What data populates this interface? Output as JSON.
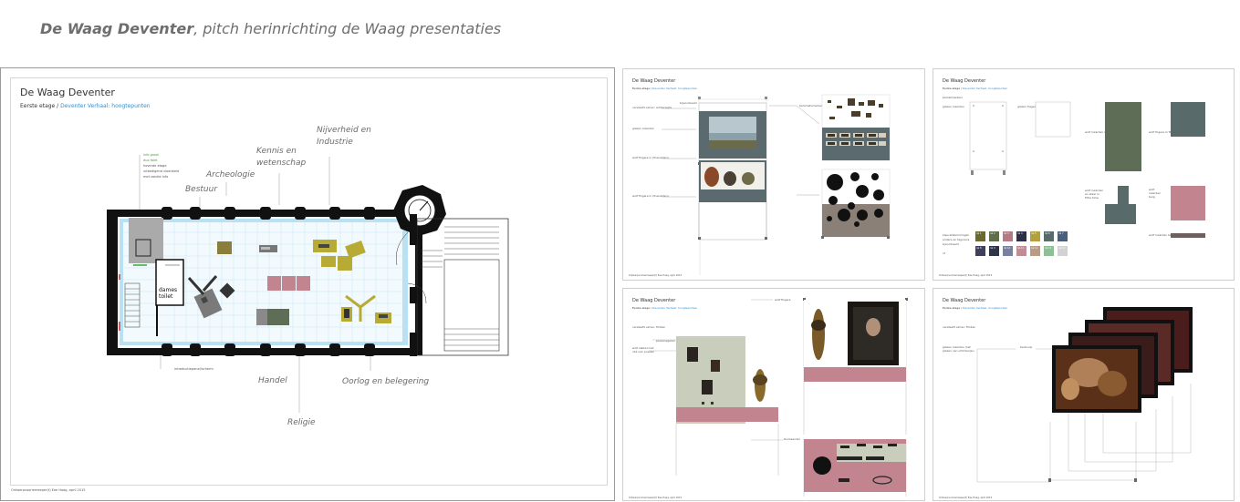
{
  "header": {
    "title_bold": "De Waag Deventer",
    "title_rest": ", pitch herinrichting de Waag presentaties"
  },
  "main_board": {
    "title": "De Waag Deventer",
    "subtitle_plain": "Eerste etage / ",
    "subtitle_link": "Deventer Verhaal: hoogtepunten",
    "zones": {
      "archeologie": "Archeologie",
      "bestuur": "Bestuur",
      "kennis": [
        "Kennis en",
        "wetenschap"
      ],
      "nijverheid": [
        "Nijverheid en",
        "Industrie"
      ],
      "handel": "Handel",
      "religie": "Religie",
      "oorlog": "Oorlog en belegering"
    },
    "legend": [
      "info groot",
      "duo falet",
      "hoverde etage",
      "uitbedigend vloerbield",
      "met zandie info"
    ],
    "toilet_label": [
      "dames",
      "toilet"
    ],
    "screen_label": "introductiepanel/scherm",
    "footer": "Ontwerpvoorlemeeper(t) Eee Haag, april 2015"
  },
  "board_b": {
    "title": "De Waag Deventer",
    "subtitle_plain": "Eerste etage / ",
    "subtitle_link": "Deventer Verhaal: hoogtepunten",
    "labels": [
      "vandeefd simao: achterlegte",
      "glazen inzarden",
      "wolf fixgere in (thenalden)",
      "wolf fixgere in (thenalden)",
      "bijvoorbeeld",
      "bammatomerken",
      "tegem 4469 12x1 + 5x",
      "tegem 4469 12x1 + 5x",
      "tambar",
      "klaras"
    ],
    "footer": "Ontwerpvoorlemeeper(t) Eee Haag, april 2015"
  },
  "board_c": {
    "title": "De Waag Deventer",
    "subtitle_plain": "Eerste etage / ",
    "subtitle_link": "Deventer Verhaal: hoogtepunten",
    "labels": [
      "bamatmarkers",
      "glazen inzarden",
      "glazen fragers",
      "wolf inzarden rondam",
      "wolf frigere in filtre",
      "wolf inzarden en staal in filtre blow",
      "wolf inzarden berg",
      "wolf inzarden berg",
      "kleurafstemmingen",
      "andere en fagorens",
      "bjvoorbeeld",
      "of"
    ],
    "swatches": [
      {
        "label": "ral 1",
        "color": "#6b6a2c"
      },
      {
        "label": "ral 2",
        "color": "#5f6d4c"
      },
      {
        "label": "ral 3",
        "color": "#b57a85"
      },
      {
        "label": "ral 4",
        "color": "#2e2e45"
      },
      {
        "label": "ral 5",
        "color": "#b4a13c"
      },
      {
        "label": "ral 6",
        "color": "#596c6b"
      },
      {
        "label": "ral 7",
        "color": "#4a5e7e"
      },
      {
        "label": "ral 8",
        "color": "#3f3f5e"
      },
      {
        "label": "ral 9",
        "color": "#2f3448"
      },
      {
        "label": "ral 10",
        "color": "#7a7fa4"
      },
      {
        "label": "ral 11",
        "color": "#bf8d96"
      },
      {
        "label": "ral 12",
        "color": "#b99c82"
      },
      {
        "label": "ral 13",
        "color": "#8fbf96"
      },
      {
        "label": "ral 14",
        "color": "#d2d2d2"
      }
    ],
    "footer": "Ontwerpvoorlemeeper(t) Eee Haag, april 2015"
  },
  "board_d": {
    "title": "De Waag Deventer",
    "subtitle_plain": "Eerste etage / ",
    "subtitle_link": "Deventer Verhaal: hoogtepunten",
    "labels": [
      "vandeefd simao: fimbsn",
      "personagaren",
      "wolf zakkel met obk van poeden",
      "wolf fixgere",
      "fenmsander"
    ],
    "footer": "Ontwerpvoorlemeeper(t) Eee Haag, april 2015"
  },
  "board_e": {
    "title": "De Waag Deventer",
    "subtitle_plain": "Eerste etage / ",
    "subtitle_link": "Deventer Verhaal: hoogtepunten",
    "labels": [
      "vandeefd simao: fimbsn",
      "glazen inzarden met glazen van schilderijen",
      "berbouw"
    ],
    "footer": "Ontwerpvoorlemeeper(t) Eee Haag, april 2015"
  },
  "colors": {
    "olive": "#8b7d3a",
    "olive_yellow": "#b8ab35",
    "rose": "#c2858f",
    "sage": "#5e6d56",
    "slate": "#596a6b",
    "floor_blue": "#9fd3ee",
    "link_blue": "#2d8fd6"
  }
}
